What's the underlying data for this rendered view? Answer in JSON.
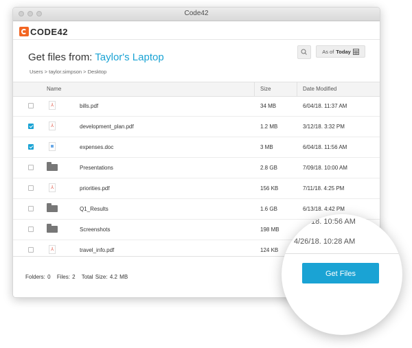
{
  "window": {
    "title": "Code42"
  },
  "brand": {
    "logo_text": "CODE42"
  },
  "header": {
    "title_prefix": "Get files from: ",
    "device": "Taylor's Laptop",
    "breadcrumb": "Users >  taylor.simpson  > Desktop",
    "asof_prefix": "As of",
    "asof_value": "Today"
  },
  "table": {
    "columns": [
      "Name",
      "Size",
      "Date Modified"
    ],
    "rows": [
      {
        "checked": false,
        "type": "pdf",
        "name": "bills.pdf",
        "size": "34 MB",
        "date": "6/04/18. 11:37 AM"
      },
      {
        "checked": true,
        "type": "pdf",
        "name": "development_plan.pdf",
        "size": "1.2 MB",
        "date": "3/12/18. 3:32 PM"
      },
      {
        "checked": true,
        "type": "doc",
        "name": "expenses.doc",
        "size": "3 MB",
        "date": "6/04/18. 11:56 AM"
      },
      {
        "checked": false,
        "type": "folder",
        "name": "Presentations",
        "size": "2.8 GB",
        "date": "7/09/18. 10:00 AM"
      },
      {
        "checked": false,
        "type": "pdf",
        "name": "priorities.pdf",
        "size": "156 KB",
        "date": "7/11/18. 4:25 PM"
      },
      {
        "checked": false,
        "type": "folder",
        "name": "Q1_Results",
        "size": "1.6 GB",
        "date": "6/13/18. 4:42 PM"
      },
      {
        "checked": false,
        "type": "folder",
        "name": "Screenshots",
        "size": "198 MB",
        "date": ""
      },
      {
        "checked": false,
        "type": "pdf",
        "name": "travel_info.pdf",
        "size": "124 KB",
        "date": ""
      }
    ]
  },
  "footer": {
    "folders": "Folders: 0",
    "files": "Files: 2",
    "total": "Total Size: 4.2 MB"
  },
  "magnifier": {
    "date1": "/18. 10:56 AM",
    "date2": "4/26/18. 10:28 AM",
    "button_label": "Get Files"
  },
  "colors": {
    "accent": "#1aa3d4",
    "logo": "#f26522"
  }
}
